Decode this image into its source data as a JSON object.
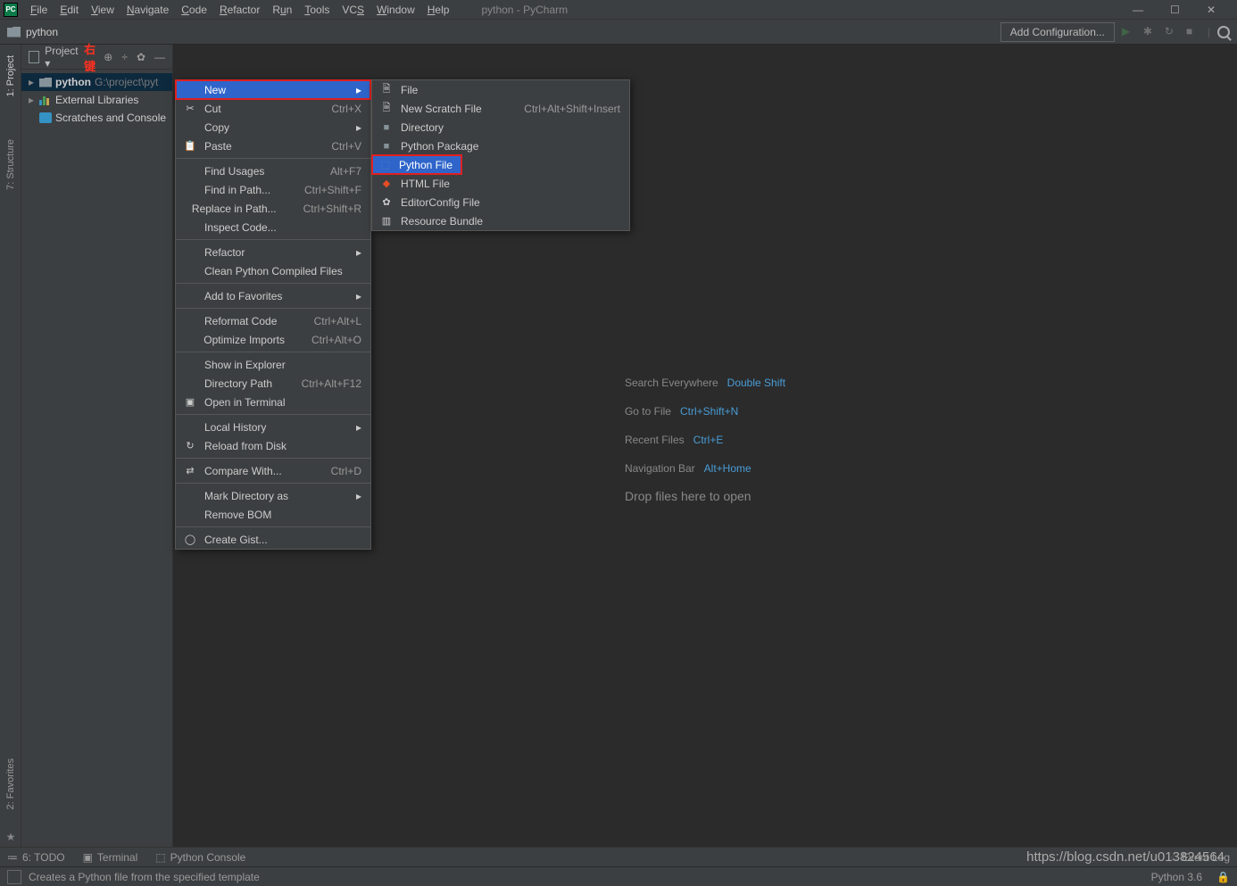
{
  "window": {
    "title": "python - PyCharm"
  },
  "menu": {
    "file": "File",
    "edit": "Edit",
    "view": "View",
    "navigate": "Navigate",
    "code": "Code",
    "refactor": "Refactor",
    "run": "Run",
    "tools": "Tools",
    "vcs": "VCS",
    "window": "Window",
    "help": "Help"
  },
  "nav": {
    "project": "python",
    "addconfig": "Add Configuration..."
  },
  "lefttabs": {
    "project": "1: Project",
    "structure": "7: Structure",
    "favorites": "2: Favorites"
  },
  "sidebar": {
    "header": "Project",
    "annotation": "右键",
    "root": {
      "name": "python",
      "path": "G:\\project\\pyt"
    },
    "ext": "External Libraries",
    "scratch": "Scratches and Console"
  },
  "context": {
    "new": "New",
    "cut": {
      "l": "Cut",
      "s": "Ctrl+X"
    },
    "copy": {
      "l": "Copy"
    },
    "paste": {
      "l": "Paste",
      "s": "Ctrl+V"
    },
    "findusages": {
      "l": "Find Usages",
      "s": "Alt+F7"
    },
    "findinpath": {
      "l": "Find in Path...",
      "s": "Ctrl+Shift+F"
    },
    "replaceinpath": {
      "l": "Replace in Path...",
      "s": "Ctrl+Shift+R"
    },
    "inspect": {
      "l": "Inspect Code..."
    },
    "refactor": {
      "l": "Refactor"
    },
    "cleanpy": {
      "l": "Clean Python Compiled Files"
    },
    "addfav": {
      "l": "Add to Favorites"
    },
    "reformat": {
      "l": "Reformat Code",
      "s": "Ctrl+Alt+L"
    },
    "optimize": {
      "l": "Optimize Imports",
      "s": "Ctrl+Alt+O"
    },
    "showexp": {
      "l": "Show in Explorer"
    },
    "dirpath": {
      "l": "Directory Path",
      "s": "Ctrl+Alt+F12"
    },
    "openterm": {
      "l": "Open in Terminal"
    },
    "localhist": {
      "l": "Local History"
    },
    "reload": {
      "l": "Reload from Disk"
    },
    "compare": {
      "l": "Compare With...",
      "s": "Ctrl+D"
    },
    "markdir": {
      "l": "Mark Directory as"
    },
    "removebom": {
      "l": "Remove BOM"
    },
    "gist": {
      "l": "Create Gist..."
    }
  },
  "submenu": {
    "file": "File",
    "newscratch": {
      "l": "New Scratch File",
      "s": "Ctrl+Alt+Shift+Insert"
    },
    "directory": "Directory",
    "pypkg": "Python Package",
    "pyfile": "Python File",
    "htmlfile": "HTML File",
    "editorcfg": "EditorConfig File",
    "resbundle": "Resource Bundle"
  },
  "welcome": {
    "se": {
      "l": "Search Everywhere",
      "k": "Double Shift"
    },
    "gtf": {
      "l": "Go to File",
      "k": "Ctrl+Shift+N"
    },
    "rf": {
      "l": "Recent Files",
      "k": "Ctrl+E"
    },
    "nb": {
      "l": "Navigation Bar",
      "k": "Alt+Home"
    },
    "drop": "Drop files here to open"
  },
  "bottom": {
    "todo": "6: TODO",
    "terminal": "Terminal",
    "pyconsole": "Python Console",
    "eventlog": "Event Log"
  },
  "status": {
    "desc": "Creates a Python file from the specified template",
    "py": "Python 3.6"
  },
  "watermark": "https://blog.csdn.net/u013824564"
}
